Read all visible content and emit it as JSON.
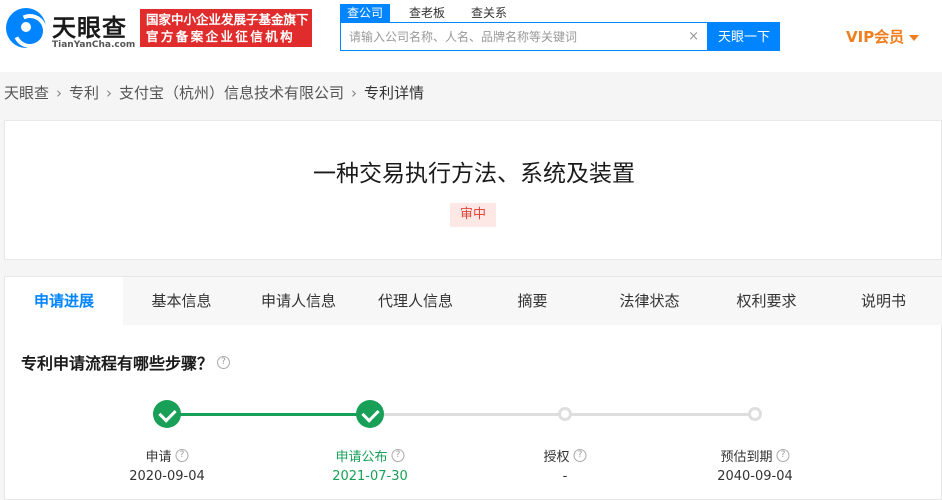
{
  "header": {
    "logo_text": "天眼查",
    "logo_sub": "TianYanCha.com",
    "banner_line1": "国家中小企业发展子基金旗下",
    "banner_line2": "官方备案企业征信机构",
    "search_tabs": [
      "查公司",
      "查老板",
      "查关系"
    ],
    "search_placeholder": "请输入公司名称、人名、品牌名称等关键词",
    "clear_label": "×",
    "search_button": "天眼一下",
    "vip_label": "VIP会员"
  },
  "breadcrumb": [
    "天眼查",
    "专利",
    "支付宝（杭州）信息技术有限公司",
    "专利详情"
  ],
  "breadcrumb_sep": "›",
  "patent": {
    "title": "一种交易执行方法、系统及装置",
    "status": "审中"
  },
  "tabs": [
    "申请进展",
    "基本信息",
    "申请人信息",
    "代理人信息",
    "摘要",
    "法律状态",
    "权利要求",
    "说明书"
  ],
  "active_tab": 0,
  "progress": {
    "heading": "专利申请流程有哪些步骤？",
    "help_glyph": "?",
    "completed_steps": 2,
    "steps": [
      {
        "label": "申请",
        "date": "2020-09-04"
      },
      {
        "label": "申请公布",
        "date": "2021-07-30"
      },
      {
        "label": "授权",
        "date": "-"
      },
      {
        "label": "预估到期",
        "date": "2040-09-04"
      }
    ]
  },
  "colors": {
    "brand_blue": "#0084ff",
    "done_green": "#18a058",
    "vip_orange": "#f07d1e",
    "banner_red": "#e02c2c"
  }
}
